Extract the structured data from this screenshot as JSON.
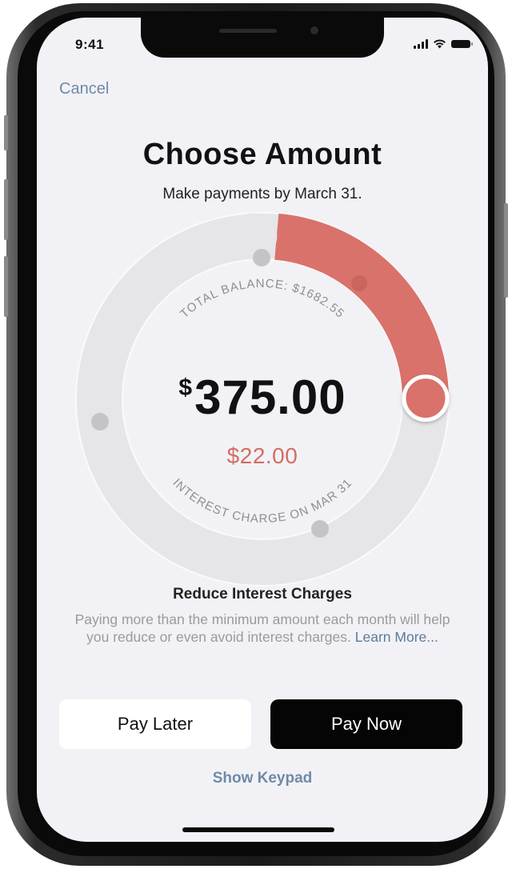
{
  "status_bar": {
    "time": "9:41",
    "icons": [
      "cellular-signal-icon",
      "wifi-icon",
      "battery-icon"
    ]
  },
  "nav": {
    "cancel_label": "Cancel"
  },
  "header": {
    "title": "Choose Amount",
    "subtitle": "Make payments by March 31."
  },
  "dial": {
    "total_balance_label": "TOTAL BALANCE: $1682.55",
    "currency_symbol": "$",
    "amount": "375.00",
    "interest_amount": "$22.00",
    "interest_label": "INTEREST CHARGE ON MAR 31",
    "selected_fraction": 0.235,
    "colors": {
      "track": "#e6e6e8",
      "fill": "#d9726a",
      "marker": "#c4c4c6"
    }
  },
  "info": {
    "title": "Reduce Interest Charges",
    "body": "Paying more than the minimum amount each month will help you reduce or even avoid interest charges.",
    "link_label": "Learn More..."
  },
  "actions": {
    "pay_later_label": "Pay Later",
    "pay_now_label": "Pay Now",
    "show_keypad_label": "Show Keypad"
  }
}
